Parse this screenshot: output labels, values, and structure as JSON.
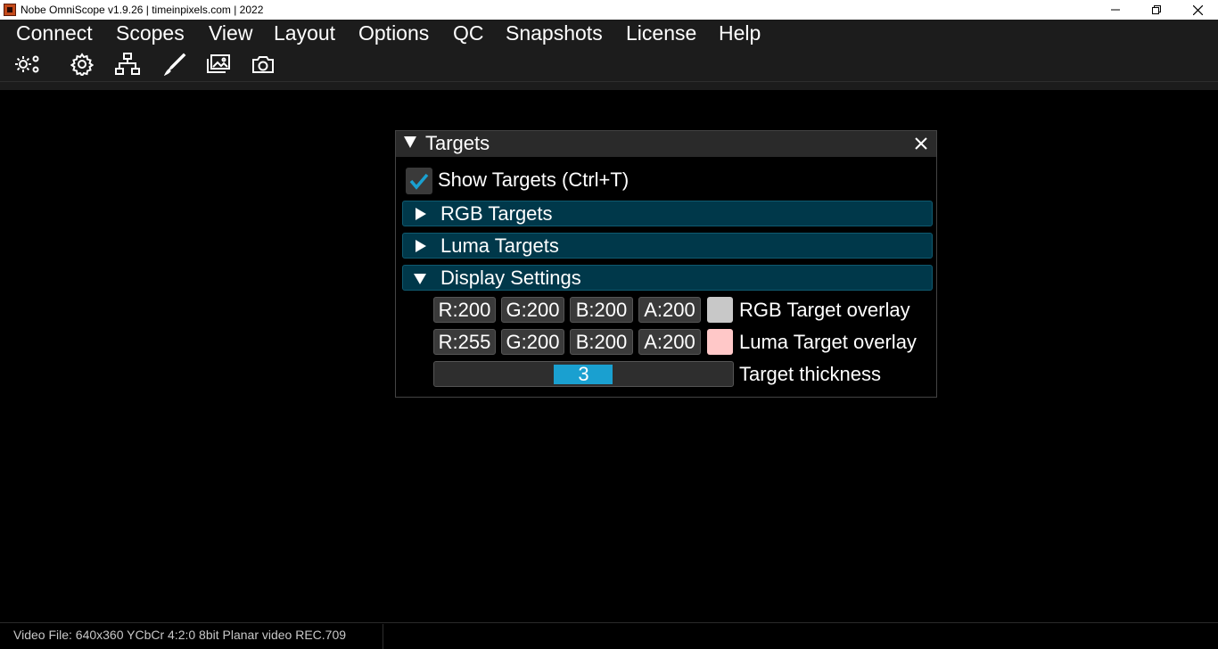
{
  "window": {
    "title": "Nobe OmniScope v1.9.26 | timeinpixels.com | 2022"
  },
  "menu": {
    "items": [
      "Connect",
      "Scopes",
      "View",
      "Layout",
      "Options",
      "QC",
      "Snapshots",
      "License",
      "Help"
    ]
  },
  "toolbar": {
    "buttons": [
      "gears-icon",
      "gear-icon",
      "network-icon",
      "brush-icon",
      "gallery-icon",
      "camera-icon"
    ]
  },
  "targets_panel": {
    "title": "Targets",
    "show_targets": {
      "label": "Show Targets (Ctrl+T)",
      "checked": true
    },
    "sections": {
      "rgb": "RGB Targets",
      "luma": "Luma Targets",
      "display": "Display Settings"
    },
    "rgb_overlay": {
      "r": "R:200",
      "g": "G:200",
      "b": "B:200",
      "a": "A:200",
      "swatch": "#c8c8c8",
      "label": "RGB Target overlay"
    },
    "luma_overlay": {
      "r": "R:255",
      "g": "G:200",
      "b": "B:200",
      "a": "A:200",
      "swatch": "#ffc8c8",
      "label": "Luma Target overlay"
    },
    "thickness": {
      "value": "3",
      "label": "Target thickness"
    }
  },
  "status": {
    "text": "Video File: 640x360 YCbCr 4:2:0 8bit Planar video REC.709"
  },
  "colors": {
    "accent": "#1aa0d0",
    "section_bg": "#00384a",
    "check": "#1aa0d0"
  }
}
